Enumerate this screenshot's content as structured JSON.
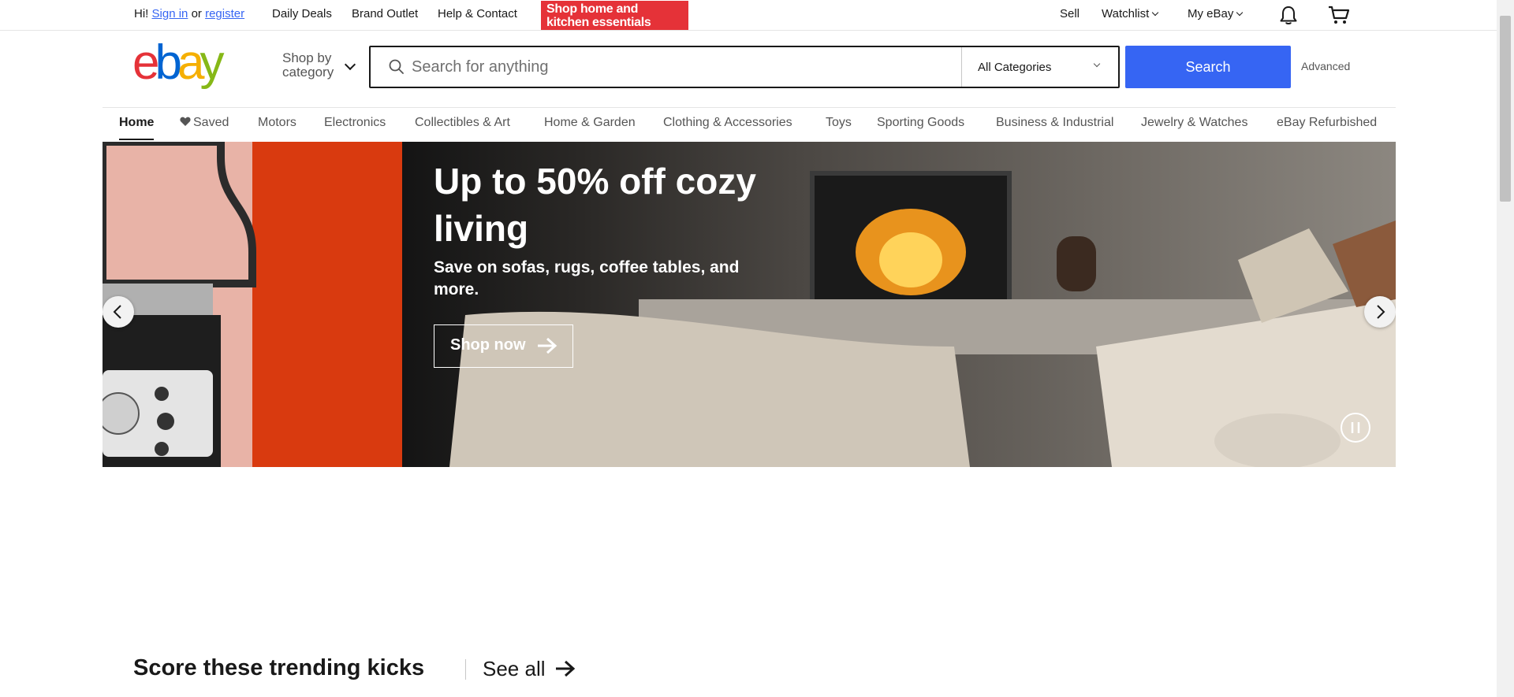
{
  "topbar": {
    "greeting": "Hi!",
    "sign_in": "Sign in",
    "or": "or",
    "register": "register",
    "daily_deals": "Daily Deals",
    "brand_outlet": "Brand Outlet",
    "help_contact": "Help & Contact",
    "promo": "Shop home and kitchen essentials",
    "sell": "Sell",
    "watchlist": "Watchlist",
    "my_ebay": "My eBay"
  },
  "header": {
    "shop_by": "Shop by",
    "category": "category",
    "search_placeholder": "Search for anything",
    "category_selected": "All Categories",
    "search_button": "Search",
    "advanced": "Advanced"
  },
  "nav": {
    "items": [
      "Home",
      "Saved",
      "Motors",
      "Electronics",
      "Collectibles & Art",
      "Home & Garden",
      "Clothing & Accessories",
      "Toys",
      "Sporting Goods",
      "Business & Industrial",
      "Jewelry & Watches",
      "eBay Refurbished"
    ]
  },
  "hero": {
    "title": "Up to 50% off cozy living",
    "subtitle": "Save on sofas, rugs, coffee tables, and more.",
    "cta": "Shop now"
  },
  "trending": {
    "title": "Score these trending kicks",
    "see_all": "See all"
  },
  "colors": {
    "brand_blue": "#3665f3",
    "brand_red": "#e53238",
    "logo_e": "#e53238",
    "logo_b": "#0064d2",
    "logo_a": "#f5af02",
    "logo_y": "#86b817"
  },
  "icons": [
    "search-icon",
    "chevron-down-icon",
    "bell-icon",
    "cart-icon",
    "heart-icon",
    "arrow-right-icon",
    "chevron-left-icon",
    "chevron-right-icon",
    "pause-icon"
  ]
}
